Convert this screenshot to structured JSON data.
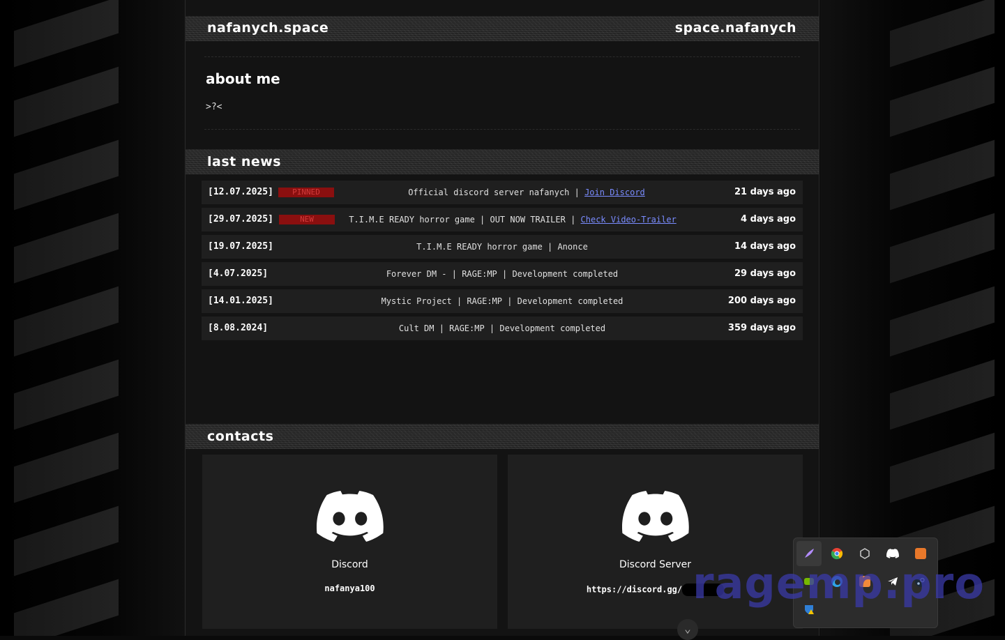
{
  "header": {
    "left_title": "nafanych.space",
    "right_title": "space.nafanych"
  },
  "about": {
    "title": "about me",
    "text": ">?<"
  },
  "news": {
    "title": "last news",
    "items": [
      {
        "date": "[12.07.2025]",
        "badge": "PINNED",
        "text": "Official discord server nafanych  |",
        "link": "Join Discord",
        "ago": "21 days ago"
      },
      {
        "date": "[29.07.2025]",
        "badge": "NEW",
        "text": "T.I.M.E READY horror game | OUT NOW TRAILER  |",
        "link": "Check Video-Trailer",
        "ago": "4 days ago"
      },
      {
        "date": "[19.07.2025]",
        "badge": "",
        "text": "T.I.M.E READY horror game | Anonce",
        "link": "",
        "ago": "14 days ago"
      },
      {
        "date": "[4.07.2025]",
        "badge": "",
        "text": "Forever DM - | RAGE:MP | Development completed",
        "link": "",
        "ago": "29 days ago"
      },
      {
        "date": "[14.01.2025]",
        "badge": "",
        "text": "Mystic Project | RAGE:MP | Development completed",
        "link": "",
        "ago": "200 days ago"
      },
      {
        "date": "[8.08.2024]",
        "badge": "",
        "text": "Cult DM | RAGE:MP | Development completed",
        "link": "",
        "ago": "359 days ago"
      }
    ]
  },
  "contacts": {
    "title": "contacts",
    "cards": [
      {
        "title": "Discord",
        "value": "nafanya100"
      },
      {
        "title": "Discord Server",
        "value": "https://discord.gg/"
      }
    ]
  },
  "tray": {
    "icons": [
      "feather-icon",
      "chrome-icon",
      "hex-icon",
      "discord-icon",
      "orange-app-icon",
      "nvidia-icon",
      "edge-icon",
      "xampp-icon",
      "telegram-icon",
      "steam-icon",
      "shield-warning-icon"
    ],
    "colors": {
      "chrome": "#e94235",
      "discord": "#ffffff",
      "orange": "#e8782a",
      "edge": "#2fa5e8",
      "telegram": "#ffffff",
      "steam": "#9bb6d6",
      "feather": "#b38cff",
      "nvidia": "#76b900"
    }
  },
  "watermark": "ragemp.pro",
  "theme": {
    "badge_bg": "#8a0f0f",
    "link": "#7a8cff",
    "row_bg": "#1f1f1f"
  }
}
